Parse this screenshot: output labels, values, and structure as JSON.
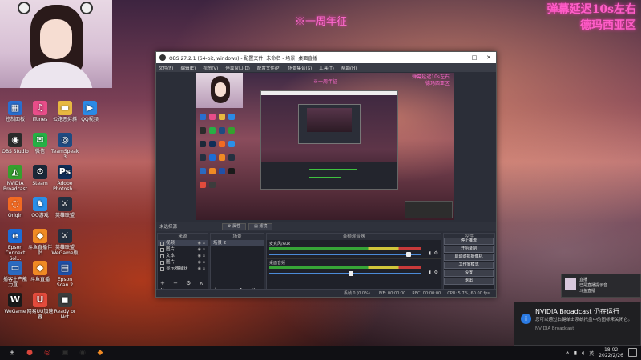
{
  "overlay": {
    "top_center": "※一周年征",
    "top_right_line1": "弹幕延迟10s左右",
    "top_right_line2": "德玛西亚区"
  },
  "desktop_icons": [
    {
      "label": "控制面板",
      "icon": "control-panel-icon",
      "color": "#2a6fd0",
      "glyph": "▦"
    },
    {
      "label": "iTunes",
      "icon": "itunes-icon",
      "color": "#e84d89",
      "glyph": "♫"
    },
    {
      "label": "公路恶劣斜",
      "icon": "folder-icon",
      "color": "#e7b840",
      "glyph": "▬"
    },
    {
      "label": "QQ视频",
      "icon": "qq-video-icon",
      "color": "#2b8ae6",
      "glyph": "▶"
    },
    {
      "label": "OBS Studio",
      "icon": "obs-icon",
      "color": "#2b2b2b",
      "glyph": "◉"
    },
    {
      "label": "微信",
      "icon": "wechat-icon",
      "color": "#27b045",
      "glyph": "✉"
    },
    {
      "label": "TeamSpeak 3",
      "icon": "teamspeak-icon",
      "color": "#1f4b82",
      "glyph": "◎"
    },
    {
      "label": "",
      "icon": "blank-icon",
      "color": "transparent",
      "glyph": ""
    },
    {
      "label": "NVIDIA Broadcast",
      "icon": "nvidia-broadcast-icon",
      "color": "#35a02e",
      "glyph": "◭"
    },
    {
      "label": "Steam",
      "icon": "steam-icon",
      "color": "#1b2838",
      "glyph": "⚙"
    },
    {
      "label": "Adobe Photosh...",
      "icon": "photoshop-icon",
      "color": "#0f2d57",
      "glyph": "Ps"
    },
    {
      "label": "",
      "icon": "blank-icon",
      "color": "transparent",
      "glyph": ""
    },
    {
      "label": "Origin",
      "icon": "origin-icon",
      "color": "#f26a22",
      "glyph": "◌"
    },
    {
      "label": "QQ游戏",
      "icon": "qq-game-icon",
      "color": "#2a8fe8",
      "glyph": "♞"
    },
    {
      "label": "英雄联盟",
      "icon": "lol-icon",
      "color": "#243040",
      "glyph": "⚔"
    },
    {
      "label": "",
      "icon": "blank-icon",
      "color": "transparent",
      "glyph": ""
    },
    {
      "label": "Epson Connect Sol...",
      "icon": "epson-icon",
      "color": "#1d6dd6",
      "glyph": "e"
    },
    {
      "label": "斗鱼直播伴侣",
      "icon": "douyu-icon",
      "color": "#f08a24",
      "glyph": "◆"
    },
    {
      "label": "英雄联盟WeGame版",
      "icon": "lol-wegame-icon",
      "color": "#243040",
      "glyph": "⚔"
    },
    {
      "label": "",
      "icon": "blank-icon",
      "color": "transparent",
      "glyph": ""
    },
    {
      "label": "播客生产能力直...",
      "icon": "monitor-icon",
      "color": "#2b6ac0",
      "glyph": "▭"
    },
    {
      "label": "斗鱼直播",
      "icon": "douyu-live-icon",
      "color": "#f08a24",
      "glyph": "◆"
    },
    {
      "label": "Epson Scan 2",
      "icon": "epson-scan-icon",
      "color": "#2050a8",
      "glyph": "▤"
    },
    {
      "label": "",
      "icon": "blank-icon",
      "color": "transparent",
      "glyph": ""
    },
    {
      "label": "WeGame",
      "icon": "wegame-icon",
      "color": "#1a1a1a",
      "glyph": "W"
    },
    {
      "label": "网易UU加速器",
      "icon": "uu-icon",
      "color": "#e34b3c",
      "glyph": "U"
    },
    {
      "label": "Ready or Not",
      "icon": "ready-or-not-icon",
      "color": "#3c3c3c",
      "glyph": "◼"
    }
  ],
  "obs": {
    "title": "OBS 27.2.1 (64-bit, windows) - 配置文件: 未命名 - 场景: 桌面直播",
    "menu": [
      "文件(F)",
      "编辑(E)",
      "视图(V)",
      "停靠窗口(D)",
      "配置文件(P)",
      "场景集合(S)",
      "工具(T)",
      "帮助(H)"
    ],
    "no_source_selected": "未选择源",
    "props_button": "属性",
    "filters_button": "滤镜",
    "preview_text_center": "※一周年征",
    "preview_text_right1": "弹幕延迟10s左右",
    "preview_text_right2": "德玛西亚区",
    "sources_header": "来源",
    "sources": [
      {
        "name": "视频",
        "selected": true
      },
      {
        "name": "图片",
        "selected": false
      },
      {
        "name": "文本",
        "selected": false
      },
      {
        "name": "图片",
        "selected": false
      },
      {
        "name": "显示器捕获",
        "selected": false
      }
    ],
    "scenes_header": "场景",
    "scenes": [
      "场景 2"
    ],
    "mixer_header": "音频混音器",
    "mixer_tracks": [
      {
        "label": "麦克风/Aux",
        "level": 0.92
      },
      {
        "label": "桌面音频",
        "level": 0.53
      }
    ],
    "controls_header": "控件",
    "controls": [
      "停止推流",
      "开始录制",
      "启动虚拟摄像机",
      "工作室模式",
      "设置",
      "退出"
    ],
    "status": {
      "dropped": "丢帧 0 (0.0%)",
      "live": "LIVE: 00:00:00",
      "rec": "REC: 00:00:00",
      "cpu": "CPU: 5.7%, 60.00 fps"
    }
  },
  "notification_small": {
    "title": "直播",
    "body": "已是直播提示音",
    "sub": "斗鱼直播"
  },
  "toast": {
    "title": "NVIDIA Broadcast 仍在运行",
    "body": "您可以通过右键单击系统托盘中的图标来关闭它。",
    "app": "NVIDIA Broadcast"
  },
  "taskbar": {
    "time": "18:02",
    "date": "2022/2/26",
    "lang": "英",
    "apps": [
      {
        "icon": "windows-start-icon",
        "color": "#ffffff",
        "glyph": "⊞"
      },
      {
        "icon": "chrome-icon",
        "color": "#d9453b",
        "glyph": "●"
      },
      {
        "icon": "netease-music-icon",
        "color": "#d8312f",
        "glyph": "◎"
      },
      {
        "icon": "weixin-taskbar-icon",
        "color": "#2d2d2d",
        "glyph": "▣"
      },
      {
        "icon": "obs-taskbar-icon",
        "color": "#2b2b2b",
        "glyph": "◉"
      },
      {
        "icon": "douyu-taskbar-icon",
        "color": "#f08a24",
        "glyph": "◆"
      }
    ]
  }
}
